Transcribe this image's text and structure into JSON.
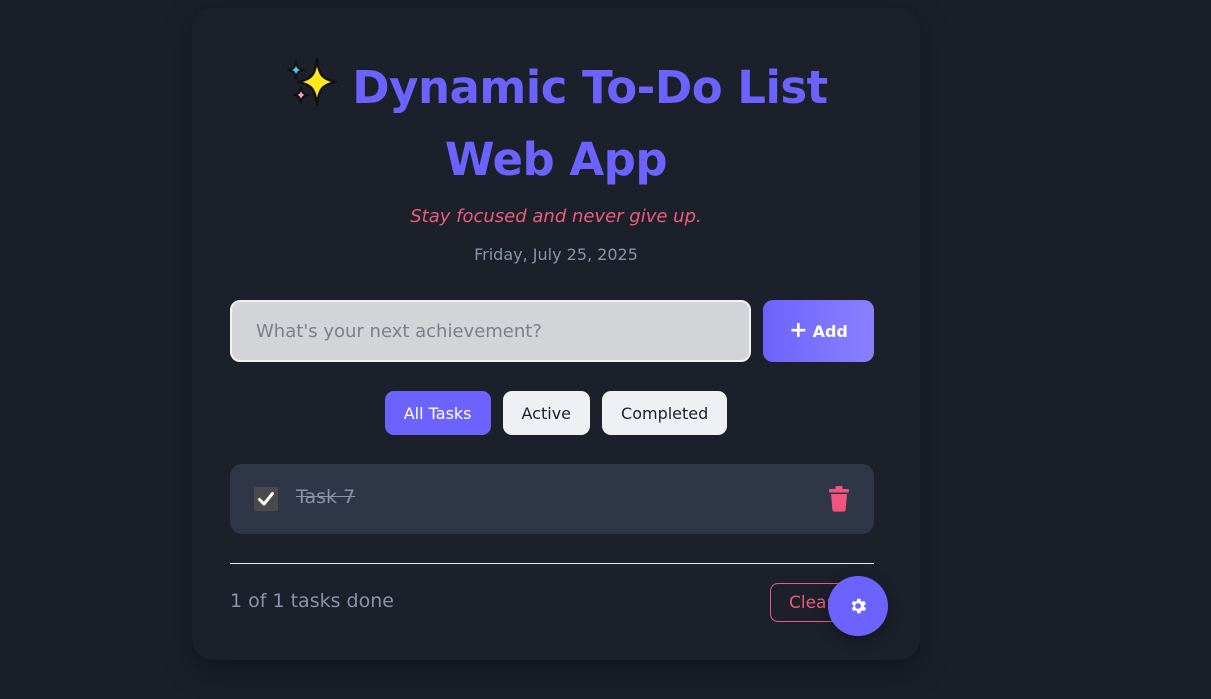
{
  "header": {
    "title_line1": "Dynamic To-Do List",
    "title_line2": "Web App",
    "title_icon": "sparkles-icon",
    "subtitle": "Stay focused and never give up.",
    "date": "Friday, July 25, 2025"
  },
  "input": {
    "placeholder": "What's your next achievement?",
    "value": ""
  },
  "add_button": {
    "icon": "plus-icon",
    "label": "Add"
  },
  "filters": [
    {
      "label": "All Tasks",
      "active": true
    },
    {
      "label": "Active",
      "active": false
    },
    {
      "label": "Completed",
      "active": false
    }
  ],
  "tasks": [
    {
      "text": "Task 7",
      "completed": true
    }
  ],
  "footer": {
    "count_text": "1 of 1 tasks done",
    "clear_label": "Clear"
  },
  "settings_button": {
    "icon": "gear-icon"
  },
  "colors": {
    "accent": "#6c63ff",
    "danger": "#ec5b7e",
    "background": "#1b1f2a",
    "task_bg": "#2f3647"
  }
}
